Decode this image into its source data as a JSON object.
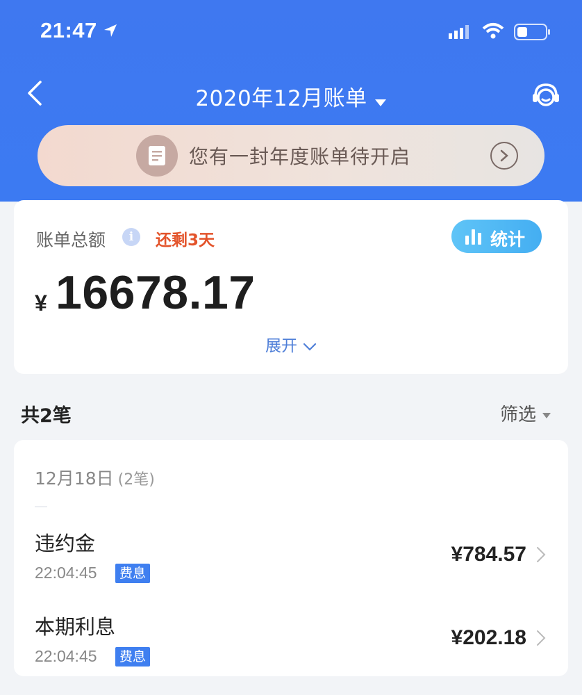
{
  "status_bar": {
    "time": "21:47"
  },
  "nav": {
    "title": "2020年12月账单"
  },
  "banner": {
    "text": "您有一封年度账单待开启"
  },
  "summary": {
    "label": "账单总额",
    "info": "i",
    "days_left": "还剩3天",
    "stats_label": "统计",
    "currency": "¥",
    "total": "16678.17",
    "expand_label": "展开"
  },
  "list_header": {
    "count": "共2笔",
    "filter": "筛选"
  },
  "groups": [
    {
      "date": "12月18日",
      "count": "(2笔)",
      "items": [
        {
          "name": "违约金",
          "time": "22:04:45",
          "tag": "费息",
          "amount": "¥784.57"
        },
        {
          "name": "本期利息",
          "time": "22:04:45",
          "tag": "费息",
          "amount": "¥202.18"
        }
      ]
    }
  ],
  "colors": {
    "header_blue": "#3f78f0",
    "warning_red": "#e3532a",
    "link_blue": "#4f7fd8",
    "tag_blue": "#3f7ff0"
  },
  "icons": [
    "location-arrow-icon",
    "signal-icon",
    "wifi-icon",
    "battery-icon",
    "back-icon",
    "caret-down-icon",
    "customer-service-icon",
    "document-icon",
    "chevron-right-icon",
    "info-icon",
    "bar-chart-icon",
    "chevron-down-icon"
  ]
}
